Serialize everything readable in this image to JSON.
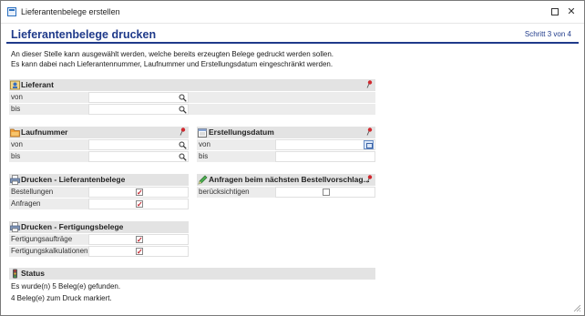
{
  "window": {
    "title": "Lieferantenbelege erstellen"
  },
  "header": {
    "title": "Lieferantenbelege drucken",
    "step": "Schritt 3 von 4"
  },
  "description": {
    "line1": "An dieser Stelle kann ausgewählt werden, welche bereits erzeugten Belege gedruckt werden sollen.",
    "line2": "Es kann dabei nach Lieferantennummer, Laufnummer und Erstellungsdatum eingeschränkt werden."
  },
  "lieferant": {
    "title": "Lieferant",
    "from_label": "von",
    "to_label": "bis",
    "from_value": "",
    "to_value": ""
  },
  "laufnummer": {
    "title": "Laufnummer",
    "from_label": "von",
    "to_label": "bis",
    "from_value": "",
    "to_value": ""
  },
  "erstellungsdatum": {
    "title": "Erstellungsdatum",
    "from_label": "von",
    "to_label": "bis",
    "from_value": "",
    "to_value": ""
  },
  "drucken_lieferantenbelege": {
    "title": "Drucken - Lieferantenbelege",
    "rows": [
      {
        "label": "Bestellungen",
        "checked": "✓"
      },
      {
        "label": "Anfragen",
        "checked": "✓"
      }
    ]
  },
  "anfragen_vorschlag": {
    "title": "Anfragen beim nächsten Bestellvorschlag...",
    "rows": [
      {
        "label": "berücksichtigen",
        "checked": ""
      }
    ]
  },
  "drucken_fertigungsbelege": {
    "title": "Drucken - Fertigungsbelege",
    "rows": [
      {
        "label": "Fertigungsaufträge",
        "checked": "✓"
      },
      {
        "label": "Fertigungskalkulationen",
        "checked": "✓"
      }
    ]
  },
  "status": {
    "title": "Status",
    "line1": "Es wurde(n) 5 Beleg(e) gefunden.",
    "line2": "4 Beleg(e) zum Druck markiert."
  },
  "icons": {
    "lieferant": "user-icon",
    "laufnummer": "folder-icon",
    "erstellungsdatum": "calendar-icon",
    "drucken": "printer-icon",
    "anfragen": "pencil-icon",
    "status": "traffic-light-icon",
    "pin": "pin-icon",
    "lookup": "magnifier-icon"
  },
  "colors": {
    "accent": "#1f3a8a",
    "pin": "#d0282e",
    "check": "#c0202a",
    "section_bg": "#e3e3e3"
  }
}
